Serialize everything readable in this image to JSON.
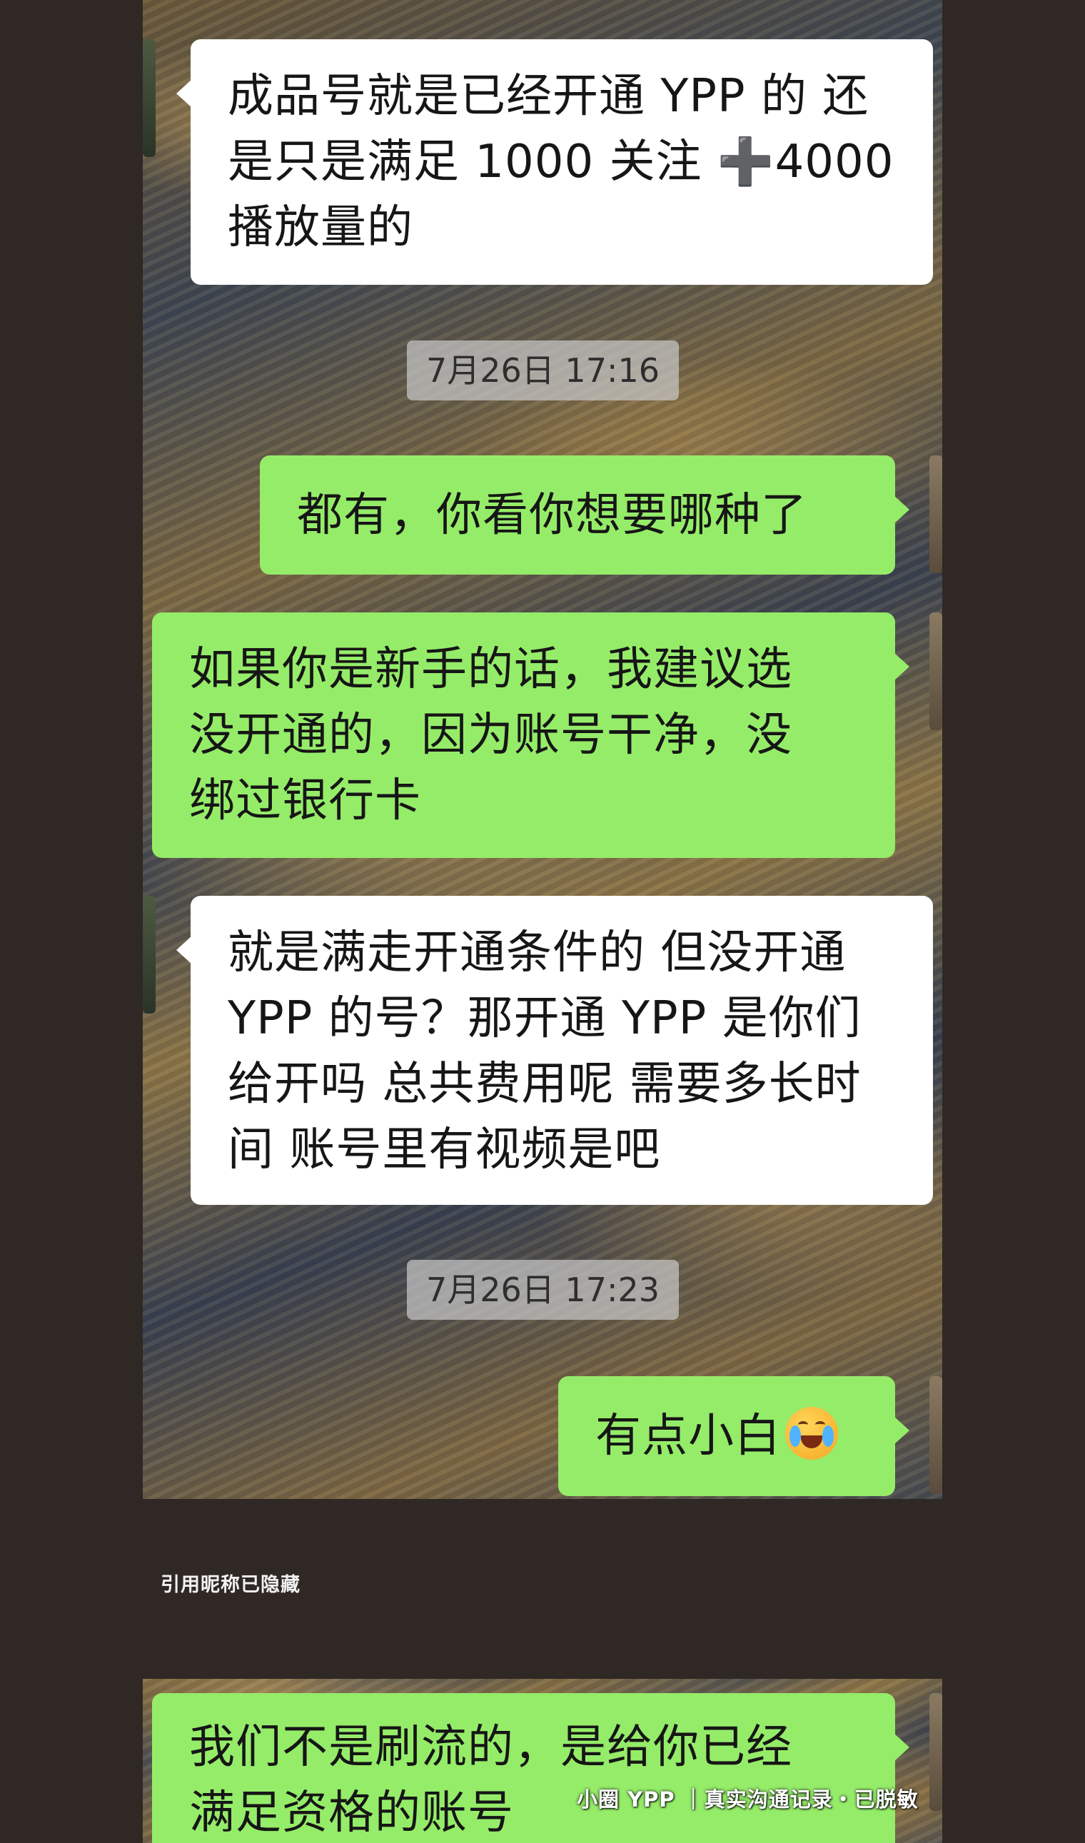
{
  "chat": {
    "messages": [
      {
        "side": "left",
        "lines": [
          "成品号就是已经开通 YPP 的 还",
          "是只是满足 1000 关注 ➕4000",
          "播放量的"
        ]
      },
      {
        "side": "right",
        "lines": [
          "都有，你看你想要哪种了"
        ]
      },
      {
        "side": "right",
        "lines": [
          "如果你是新手的话，我建议选",
          "没开通的，因为账号干净，没",
          "绑过银行卡"
        ]
      },
      {
        "side": "left",
        "lines": [
          "就是满走开通条件的 但没开通",
          "YPP 的号？那开通 YPP 是你们",
          "给开吗 总共费用呢 需要多长时",
          "间 账号里有视频是吧"
        ]
      },
      {
        "side": "right",
        "lines": [
          "有点小白"
        ],
        "emoji": "face-with-tears-of-joy-icon"
      },
      {
        "side": "right",
        "lines": [
          "我们不是刷流的，是给你已经",
          "满足资格的账号"
        ]
      }
    ],
    "timestamps": [
      "7月26日 17:16",
      "7月26日 17:23"
    ]
  },
  "caption": "引用昵称已隐藏",
  "watermark": "小圈 YPP ｜真实沟通记录・已脱敏",
  "colors": {
    "page_background": "#2f2824",
    "bubble_incoming": "#ffffff",
    "bubble_outgoing": "#95ec69",
    "timestamp_pill": "#c8c8c8"
  }
}
